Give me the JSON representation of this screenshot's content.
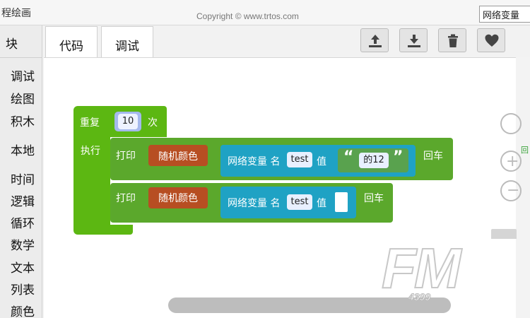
{
  "window": {
    "title": "程绘画",
    "copyright": "Copyright © www.trtos.com",
    "top_input_value": "网络变量"
  },
  "left_panel": {
    "header": "块",
    "categories": [
      "调试",
      "绘图",
      "积木",
      "本地",
      "时间",
      "逻辑",
      "循环",
      "数学",
      "文本",
      "列表",
      "颜色"
    ]
  },
  "tabs": [
    {
      "label": "代码"
    },
    {
      "label": "调试"
    }
  ],
  "toolbar": {
    "buttons": [
      {
        "icon": "upload-icon"
      },
      {
        "icon": "download-icon"
      },
      {
        "icon": "trash-icon"
      },
      {
        "icon": "heart-icon"
      }
    ]
  },
  "blocks": {
    "repeat": {
      "label": "重复",
      "count": "10",
      "unit": "次",
      "exec_label": "执行"
    },
    "print1": {
      "label": "打印",
      "color_block": "随机颜色",
      "netvar_prefix": "网络变量 名",
      "name": "test",
      "value_label": "值",
      "string_open": "“",
      "string_value": "的12",
      "string_close": "”",
      "newline": "回车"
    },
    "print2": {
      "label": "打印",
      "color_block": "随机颜色",
      "netvar_prefix": "网络变量 名",
      "name": "test",
      "value_label": "值",
      "newline": "回车"
    }
  },
  "colors": {
    "loop_green": "#5cb712",
    "print_green": "#5ba82c",
    "color_block": "#b74e22",
    "netvar_teal": "#1fa2c4",
    "text_green": "#59a24e",
    "repeat_field": "#a5b9ed"
  },
  "watermark": {
    "brand": "FM",
    "sub": "4399"
  },
  "side_label": "回"
}
